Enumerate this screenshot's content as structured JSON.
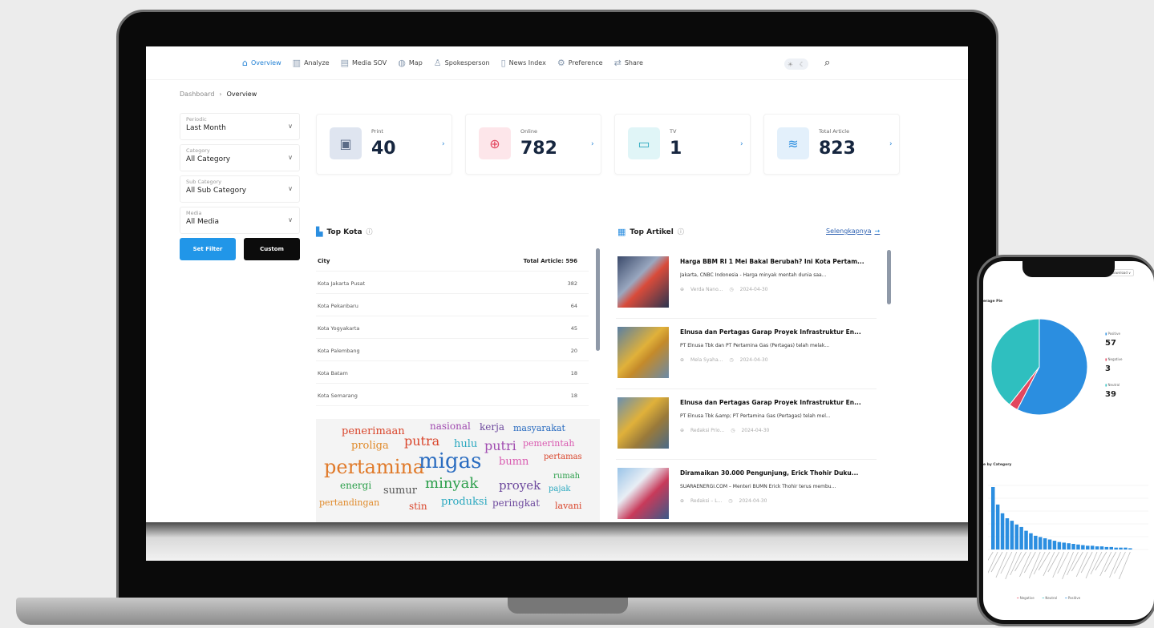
{
  "nav": {
    "items": [
      {
        "label": "Overview",
        "icon": "home-icon",
        "glyph": "⌂"
      },
      {
        "label": "Analyze",
        "icon": "bar-chart-icon",
        "glyph": "▥"
      },
      {
        "label": "Media SOV",
        "icon": "media-icon",
        "glyph": "▤"
      },
      {
        "label": "Map",
        "icon": "globe-icon",
        "glyph": "◍"
      },
      {
        "label": "Spokesperson",
        "icon": "person-icon",
        "glyph": "♙"
      },
      {
        "label": "News Index",
        "icon": "document-icon",
        "glyph": "▯"
      },
      {
        "label": "Preference",
        "icon": "gear-icon",
        "glyph": "⚙"
      },
      {
        "label": "Share",
        "icon": "share-icon",
        "glyph": "⇄"
      }
    ],
    "active": "Overview"
  },
  "breadcrumb": {
    "root": "Dashboard",
    "current": "Overview"
  },
  "filters": [
    {
      "label": "Periodic",
      "value": "Last Month"
    },
    {
      "label": "Category",
      "value": "All Category"
    },
    {
      "label": "Sub Category",
      "value": "All Sub Category"
    },
    {
      "label": "Media",
      "value": "All Media"
    }
  ],
  "buttons": {
    "set_filter": "Set Filter",
    "custom": "Custom"
  },
  "stats": [
    {
      "label": "Print",
      "value": "40",
      "icon": "newspaper-icon",
      "glyph": "▣",
      "color": "#dfe5f0",
      "fg": "#5a6b86"
    },
    {
      "label": "Online",
      "value": "782",
      "icon": "globe-icon",
      "glyph": "⊕",
      "color": "#fde6ea",
      "fg": "#e2475f"
    },
    {
      "label": "TV",
      "value": "1",
      "icon": "tv-icon",
      "glyph": "▭",
      "color": "#e0f5f7",
      "fg": "#2aa8bf"
    },
    {
      "label": "Total Article",
      "value": "823",
      "icon": "layers-icon",
      "glyph": "≋",
      "color": "#e3f0fb",
      "fg": "#2b8ee0"
    }
  ],
  "top_kota": {
    "title": "Top Kota",
    "col_city": "City",
    "col_total": "Total Article: 596",
    "rows": [
      {
        "city": "Kota Jakarta Pusat",
        "count": "382"
      },
      {
        "city": "Kota Pekanbaru",
        "count": "64"
      },
      {
        "city": "Kota Yogyakarta",
        "count": "45"
      },
      {
        "city": "Kota Palembang",
        "count": "20"
      },
      {
        "city": "Kota Batam",
        "count": "18"
      },
      {
        "city": "Kota Semarang",
        "count": "18"
      }
    ]
  },
  "word_cloud": [
    {
      "w": "penerimaan",
      "c": "#d9452b",
      "s": 13
    },
    {
      "w": "nasional",
      "c": "#a04bb0",
      "s": 12
    },
    {
      "w": "kerja",
      "c": "#6e4a9e",
      "s": 12
    },
    {
      "w": "masyarakat",
      "c": "#2a6cc0",
      "s": 11
    },
    {
      "w": "proliga",
      "c": "#e08a2a",
      "s": 13
    },
    {
      "w": "putra",
      "c": "#d9452b",
      "s": 16
    },
    {
      "w": "hulu",
      "c": "#2aa8bf",
      "s": 13
    },
    {
      "w": "putri",
      "c": "#a04bb0",
      "s": 16
    },
    {
      "w": "pemerintah",
      "c": "#d95ab0",
      "s": 11
    },
    {
      "w": "pertamina",
      "c": "#e07a2a",
      "s": 24
    },
    {
      "w": "migas",
      "c": "#2a6cc0",
      "s": 26
    },
    {
      "w": "bumn",
      "c": "#d95ab0",
      "s": 13
    },
    {
      "w": "pertamas",
      "c": "#d9452b",
      "s": 10
    },
    {
      "w": "energi",
      "c": "#2a9e4a",
      "s": 12
    },
    {
      "w": "sumur",
      "c": "#555555",
      "s": 13
    },
    {
      "w": "minyak",
      "c": "#2a9e4a",
      "s": 18
    },
    {
      "w": "proyek",
      "c": "#6e4a9e",
      "s": 15
    },
    {
      "w": "rumah",
      "c": "#2a9e4a",
      "s": 10
    },
    {
      "w": "pajak",
      "c": "#2aa8bf",
      "s": 10
    },
    {
      "w": "pertandingan",
      "c": "#e08a2a",
      "s": 11
    },
    {
      "w": "stin",
      "c": "#d9452b",
      "s": 12
    },
    {
      "w": "produksi",
      "c": "#2aa8bf",
      "s": 13
    },
    {
      "w": "peringkat",
      "c": "#6e4a9e",
      "s": 12
    },
    {
      "w": "lavani",
      "c": "#d9452b",
      "s": 11
    }
  ],
  "top_artikel": {
    "title": "Top Artikel",
    "more": "Selengkapnya",
    "items": [
      {
        "title": "Harga BBM RI 1 Mei Bakal Berubah? Ini Kota Pertam...",
        "desc": "Jakarta, CNBC Indonesia - Harga minyak mentah dunia saa...",
        "author": "Verda Nano...",
        "date": "2024-04-30"
      },
      {
        "title": "Elnusa dan Pertagas Garap Proyek Infrastruktur En...",
        "desc": "PT Elnusa Tbk dan PT Pertamina Gas (Pertagas) telah melak...",
        "author": "Mela Syaha...",
        "date": "2024-04-30"
      },
      {
        "title": "Elnusa dan Pertagas Garap Proyek Infrastruktur En...",
        "desc": "PT Elnusa Tbk &amp; PT Pertamina Gas (Pertagas) telah mel...",
        "author": "Redaksi Prio...",
        "date": "2024-04-30"
      },
      {
        "title": "Diramaikan 30.000 Pengunjung, Erick Thohir Duku...",
        "desc": "SUARAENERGI.COM – Menteri BUMN Erick Thohir terus membu...",
        "author": "Redaksi – L...",
        "date": "2024-04-30"
      }
    ]
  },
  "phone": {
    "download": "Download",
    "pie_title": "erage Pie",
    "bar_title": "e by Category",
    "legend": [
      {
        "label": "Positive",
        "value": "57",
        "color": "#2b8ee0"
      },
      {
        "label": "Negative",
        "value": "3",
        "color": "#e2475f"
      },
      {
        "label": "Neutral",
        "value": "39",
        "color": "#2fbfbf"
      }
    ],
    "bottom_legend": [
      "Negative",
      "Neutral",
      "Positive"
    ],
    "bars": [
      100,
      72,
      58,
      50,
      46,
      40,
      36,
      30,
      26,
      22,
      20,
      18,
      16,
      14,
      12,
      11,
      10,
      9,
      8,
      7,
      6,
      6,
      5,
      5,
      4,
      4,
      3,
      3,
      3,
      2
    ]
  }
}
